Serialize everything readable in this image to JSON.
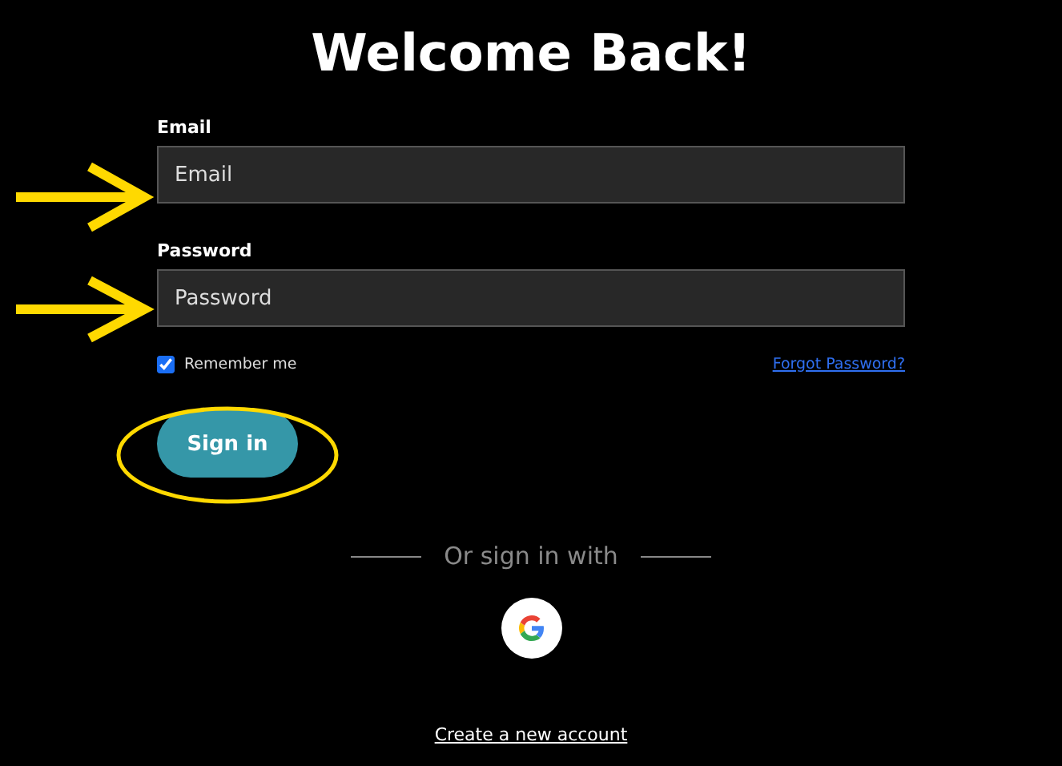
{
  "title": "Welcome Back!",
  "fields": [
    {
      "label": "Email",
      "placeholder": "Email"
    },
    {
      "label": "Password",
      "placeholder": "Password"
    }
  ],
  "remember": {
    "label": "Remember me",
    "checked": true
  },
  "forgot_link": "Forgot Password?",
  "sign_in_button": "Sign in",
  "divider_text": "Or sign in with",
  "create_account_link": "Create a new account"
}
